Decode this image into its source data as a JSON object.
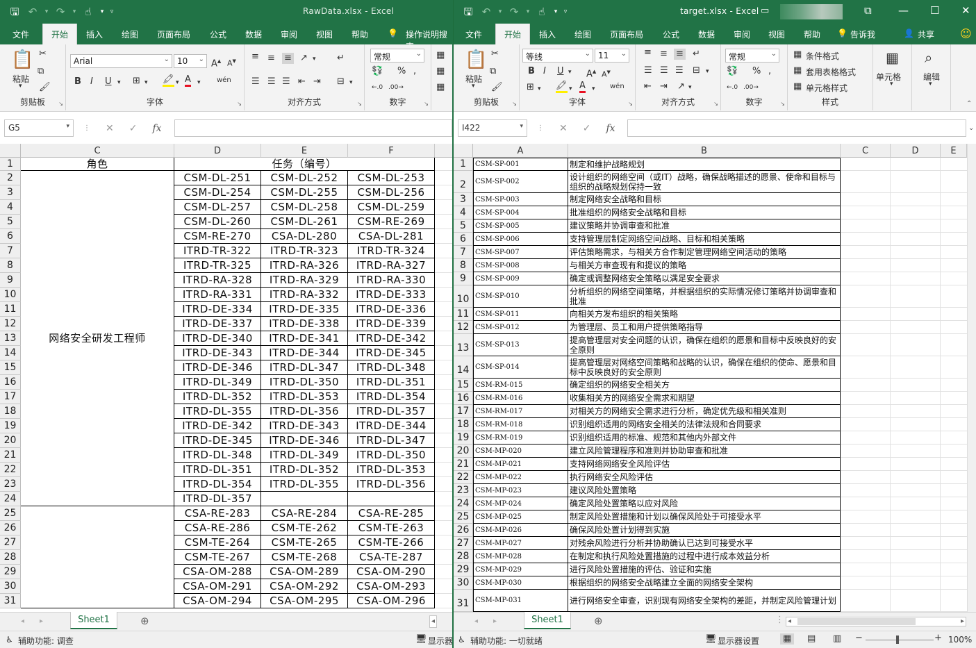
{
  "win1": {
    "title": "RawData.xlsx  -  Excel",
    "tabs": [
      "文件",
      "开始",
      "插入",
      "绘图",
      "页面布局",
      "公式",
      "数据",
      "审阅",
      "视图",
      "帮助"
    ],
    "active_tab": "开始",
    "tell_me": "操作说明搜索",
    "ribbon": {
      "paste": "粘贴",
      "clipboard": "剪贴板",
      "font_name": "Arial",
      "font_size": "10",
      "font_group": "字体",
      "align_group": "对齐方式",
      "number_format": "常规",
      "number_group": "数字"
    },
    "name_box": "G5",
    "columns": [
      "C",
      "D",
      "E",
      "F"
    ],
    "header_row": {
      "role": "角色",
      "task": "任务（编号）"
    },
    "merged_role": "网络安全研发工程师",
    "rows": [
      [
        "CSM-DL-251",
        "CSM-DL-252",
        "CSM-DL-253"
      ],
      [
        "CSM-DL-254",
        "CSM-DL-255",
        "CSM-DL-256"
      ],
      [
        "CSM-DL-257",
        "CSM-DL-258",
        "CSM-DL-259"
      ],
      [
        "CSM-DL-260",
        "CSM-DL-261",
        "CSM-RE-269"
      ],
      [
        "CSM-RE-270",
        "CSA-DL-280",
        "CSA-DL-281"
      ],
      [
        "ITRD-TR-322",
        "ITRD-TR-323",
        "ITRD-TR-324"
      ],
      [
        "ITRD-TR-325",
        "ITRD-RA-326",
        "ITRD-RA-327"
      ],
      [
        "ITRD-RA-328",
        "ITRD-RA-329",
        "ITRD-RA-330"
      ],
      [
        "ITRD-RA-331",
        "ITRD-RA-332",
        "ITRD-DE-333"
      ],
      [
        "ITRD-DE-334",
        "ITRD-DE-335",
        "ITRD-DE-336"
      ],
      [
        "ITRD-DE-337",
        "ITRD-DE-338",
        "ITRD-DE-339"
      ],
      [
        "ITRD-DE-340",
        "ITRD-DE-341",
        "ITRD-DE-342"
      ],
      [
        "ITRD-DE-343",
        "ITRD-DE-344",
        "ITRD-DE-345"
      ],
      [
        "ITRD-DE-346",
        "ITRD-DL-347",
        "ITRD-DL-348"
      ],
      [
        "ITRD-DL-349",
        "ITRD-DL-350",
        "ITRD-DL-351"
      ],
      [
        "ITRD-DL-352",
        "ITRD-DL-353",
        "ITRD-DL-354"
      ],
      [
        "ITRD-DL-355",
        "ITRD-DL-356",
        "ITRD-DL-357"
      ],
      [
        "ITRD-DE-342",
        "ITRD-DE-343",
        "ITRD-DE-344"
      ],
      [
        "ITRD-DE-345",
        "ITRD-DE-346",
        "ITRD-DL-347"
      ],
      [
        "ITRD-DL-348",
        "ITRD-DL-349",
        "ITRD-DL-350"
      ],
      [
        "ITRD-DL-351",
        "ITRD-DL-352",
        "ITRD-DL-353"
      ],
      [
        "ITRD-DL-354",
        "ITRD-DL-355",
        "ITRD-DL-356"
      ],
      [
        "ITRD-DL-357",
        "",
        ""
      ],
      [
        "CSA-RE-283",
        "CSA-RE-284",
        "CSA-RE-285"
      ],
      [
        "CSA-RE-286",
        "CSM-TE-262",
        "CSM-TE-263"
      ],
      [
        "CSM-TE-264",
        "CSM-TE-265",
        "CSM-TE-266"
      ],
      [
        "CSM-TE-267",
        "CSM-TE-268",
        "CSA-TE-287"
      ],
      [
        "CSA-OM-288",
        "CSA-OM-289",
        "CSA-OM-290"
      ],
      [
        "CSA-OM-291",
        "CSA-OM-292",
        "CSA-OM-293"
      ],
      [
        "CSA-OM-294",
        "CSA-OM-295",
        "CSA-OM-296"
      ]
    ],
    "sheet_tab": "Sheet1",
    "status_text": "辅助功能: 调查",
    "display_settings": "显示器"
  },
  "win2": {
    "title": "target.xlsx  -  Excel",
    "tabs": [
      "文件",
      "开始",
      "插入",
      "绘图",
      "页面布局",
      "公式",
      "数据",
      "审阅",
      "视图",
      "帮助"
    ],
    "active_tab": "开始",
    "tell_me": "告诉我",
    "share": "共享",
    "ribbon": {
      "paste": "粘贴",
      "clipboard": "剪贴板",
      "font_name": "等线",
      "font_size": "11",
      "font_group": "字体",
      "align_group": "对齐方式",
      "number_format": "常规",
      "number_group": "数字",
      "cond_format": "条件格式",
      "table_format": "套用表格格式",
      "cell_style": "单元格样式",
      "style_group": "样式",
      "cells": "单元格",
      "editing": "编辑"
    },
    "name_box": "I422",
    "columns": [
      "A",
      "B",
      "C",
      "D",
      "E"
    ],
    "rows": [
      [
        "CSM-SP-001",
        "制定和维护战略规划"
      ],
      [
        "CSM-SP-002",
        "设计组织的网络空间（或IT）战略，确保战略描述的愿景、使命和目标与组织的战略规划保持一致"
      ],
      [
        "CSM-SP-003",
        "制定网络安全战略和目标"
      ],
      [
        "CSM-SP-004",
        "批准组织的网络安全战略和目标"
      ],
      [
        "CSM-SP-005",
        "建议策略并协调审查和批准"
      ],
      [
        "CSM-SP-006",
        "支持管理层制定网络空间战略、目标和相关策略"
      ],
      [
        "CSM-SP-007",
        "评估策略需求，与相关方合作制定管理网络空间活动的策略"
      ],
      [
        "CSM-SP-008",
        "与相关方审查现有和提议的策略"
      ],
      [
        "CSM-SP-009",
        "确定或调整网络安全策略以满足安全要求"
      ],
      [
        "CSM-SP-010",
        "分析组织的网络空间策略，并根据组织的实际情况修订策略并协调审查和批准"
      ],
      [
        "CSM-SP-011",
        "向相关方发布组织的相关策略"
      ],
      [
        "CSM-SP-012",
        "为管理层、员工和用户提供策略指导"
      ],
      [
        "CSM-SP-013",
        "提高管理层对安全问题的认识，确保在组织的愿景和目标中反映良好的安全原则"
      ],
      [
        "CSM-SP-014",
        "提高管理层对网络空间策略和战略的认识，确保在组织的使命、愿景和目标中反映良好的安全原则"
      ],
      [
        "CSM-RM-015",
        "确定组织的网络安全相关方"
      ],
      [
        "CSM-RM-016",
        "收集相关方的网络安全需求和期望"
      ],
      [
        "CSM-RM-017",
        "对相关方的网络安全需求进行分析，确定优先级和相关准则"
      ],
      [
        "CSM-RM-018",
        "识别组织适用的网络安全相关的法律法规和合同要求"
      ],
      [
        "CSM-RM-019",
        "识别组织适用的标准、规范和其他内外部文件"
      ],
      [
        "CSM-MP-020",
        "建立风险管理程序和准则并协助审查和批准"
      ],
      [
        "CSM-MP-021",
        "支持网络网络安全风险评估"
      ],
      [
        "CSM-MP-022",
        "执行网络安全风险评估"
      ],
      [
        "CSM-MP-023",
        "建议风险处置策略"
      ],
      [
        "CSM-MP-024",
        "确定风险处置策略以应对风险"
      ],
      [
        "CSM-MP-025",
        "制定风险处置措施和计划以确保风险处于可接受水平"
      ],
      [
        "CSM-MP-026",
        "确保风险处置计划得到实施"
      ],
      [
        "CSM-MP-027",
        "对残余风险进行分析并协助确认已达到可接受水平"
      ],
      [
        "CSM-MP-028",
        "在制定和执行风险处置措施的过程中进行成本效益分析"
      ],
      [
        "CSM-MP-029",
        "进行风险处置措施的评估、验证和实施"
      ],
      [
        "CSM-MP-030",
        "根据组织的网络安全战略建立全面的网络安全架构"
      ],
      [
        "CSM-MP-031",
        "进行网络安全审查，识别现有网络安全架构的差距，并制定风险管理计划"
      ]
    ],
    "sheet_tab": "Sheet1",
    "status_text": "辅助功能: 一切就绪",
    "display_settings": "显示器设置",
    "zoom": "100%"
  },
  "icons": [
    "save-icon",
    "undo-icon",
    "redo-icon",
    "touch-mode-icon",
    "customize-icon",
    "lightbulb-icon",
    "smiley-icon",
    "person-icon"
  ]
}
